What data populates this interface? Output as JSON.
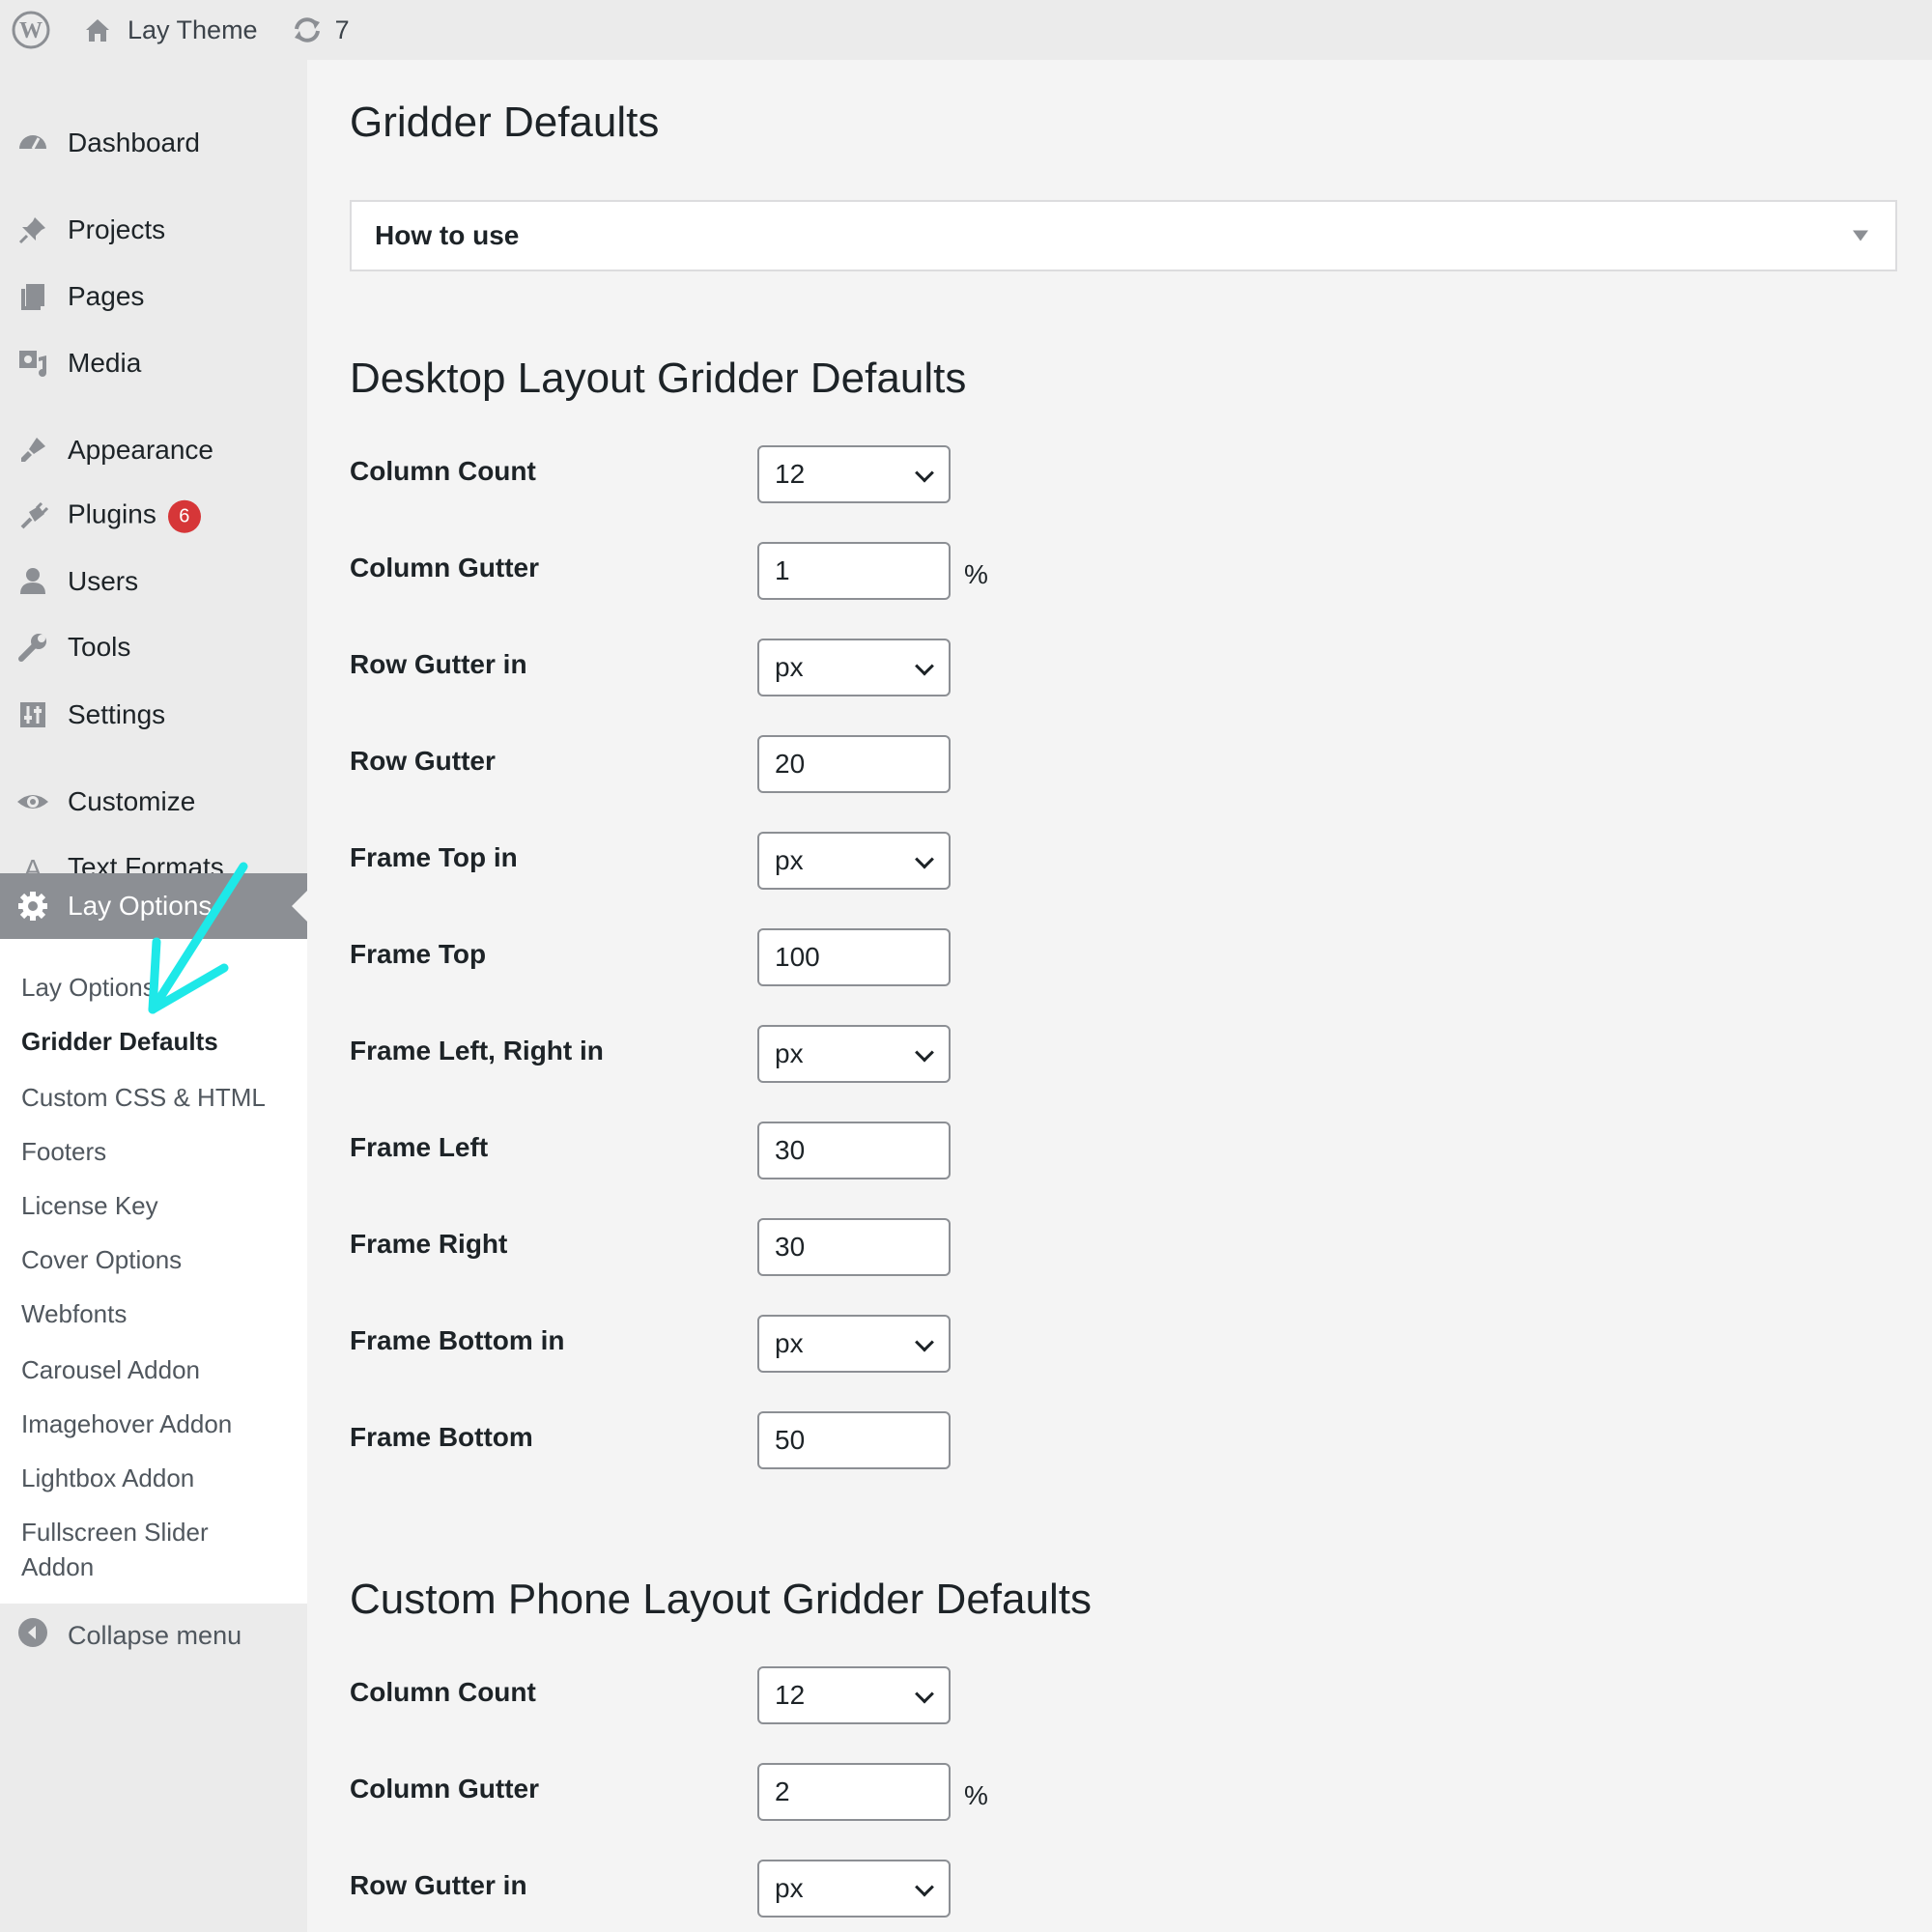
{
  "admin_bar": {
    "site_name": "Lay Theme",
    "updates_count": "7"
  },
  "sidebar": {
    "items": [
      {
        "label": "Dashboard",
        "icon": "dashboard-icon"
      },
      {
        "label": "Projects",
        "icon": "pin-icon"
      },
      {
        "label": "Pages",
        "icon": "pages-icon"
      },
      {
        "label": "Media",
        "icon": "media-icon"
      },
      {
        "label": "Appearance",
        "icon": "brush-icon"
      },
      {
        "label": "Plugins",
        "icon": "plug-icon",
        "badge": "6"
      },
      {
        "label": "Users",
        "icon": "user-icon"
      },
      {
        "label": "Tools",
        "icon": "wrench-icon"
      },
      {
        "label": "Settings",
        "icon": "sliders-icon"
      },
      {
        "label": "Customize",
        "icon": "eye-icon"
      },
      {
        "label": "Text Formats",
        "icon": "letter-a-icon"
      },
      {
        "label": "Lay Options",
        "icon": "gear-icon"
      }
    ],
    "submenu": [
      "Lay Options",
      "Gridder Defaults",
      "Custom CSS & HTML",
      "Footers",
      "License Key",
      "Cover Options",
      "Webfonts",
      "Carousel Addon",
      "Imagehover Addon",
      "Lightbox Addon",
      "Fullscreen Slider Addon"
    ],
    "collapse_label": "Collapse menu"
  },
  "main": {
    "title": "Gridder Defaults",
    "how_to_use": "How to use",
    "desktop": {
      "heading": "Desktop Layout Gridder Defaults",
      "fields": [
        {
          "label": "Column Count",
          "type": "select",
          "value": "12"
        },
        {
          "label": "Column Gutter",
          "type": "input",
          "value": "1",
          "unit": "%"
        },
        {
          "label": "Row Gutter in",
          "type": "select",
          "value": "px"
        },
        {
          "label": "Row Gutter",
          "type": "input",
          "value": "20"
        },
        {
          "label": "Frame Top in",
          "type": "select",
          "value": "px"
        },
        {
          "label": "Frame Top",
          "type": "input",
          "value": "100"
        },
        {
          "label": "Frame Left, Right in",
          "type": "select",
          "value": "px"
        },
        {
          "label": "Frame Left",
          "type": "input",
          "value": "30"
        },
        {
          "label": "Frame Right",
          "type": "input",
          "value": "30"
        },
        {
          "label": "Frame Bottom in",
          "type": "select",
          "value": "px"
        },
        {
          "label": "Frame Bottom",
          "type": "input",
          "value": "50"
        }
      ]
    },
    "phone": {
      "heading": "Custom Phone Layout Gridder Defaults",
      "fields": [
        {
          "label": "Column Count",
          "type": "select",
          "value": "12"
        },
        {
          "label": "Column Gutter",
          "type": "input",
          "value": "2",
          "unit": "%"
        },
        {
          "label": "Row Gutter in",
          "type": "select",
          "value": "px"
        }
      ]
    }
  },
  "colors": {
    "annotation_arrow": "#1ee8e8",
    "badge": "#d63638",
    "active_menu_bg": "#8c8f94"
  }
}
